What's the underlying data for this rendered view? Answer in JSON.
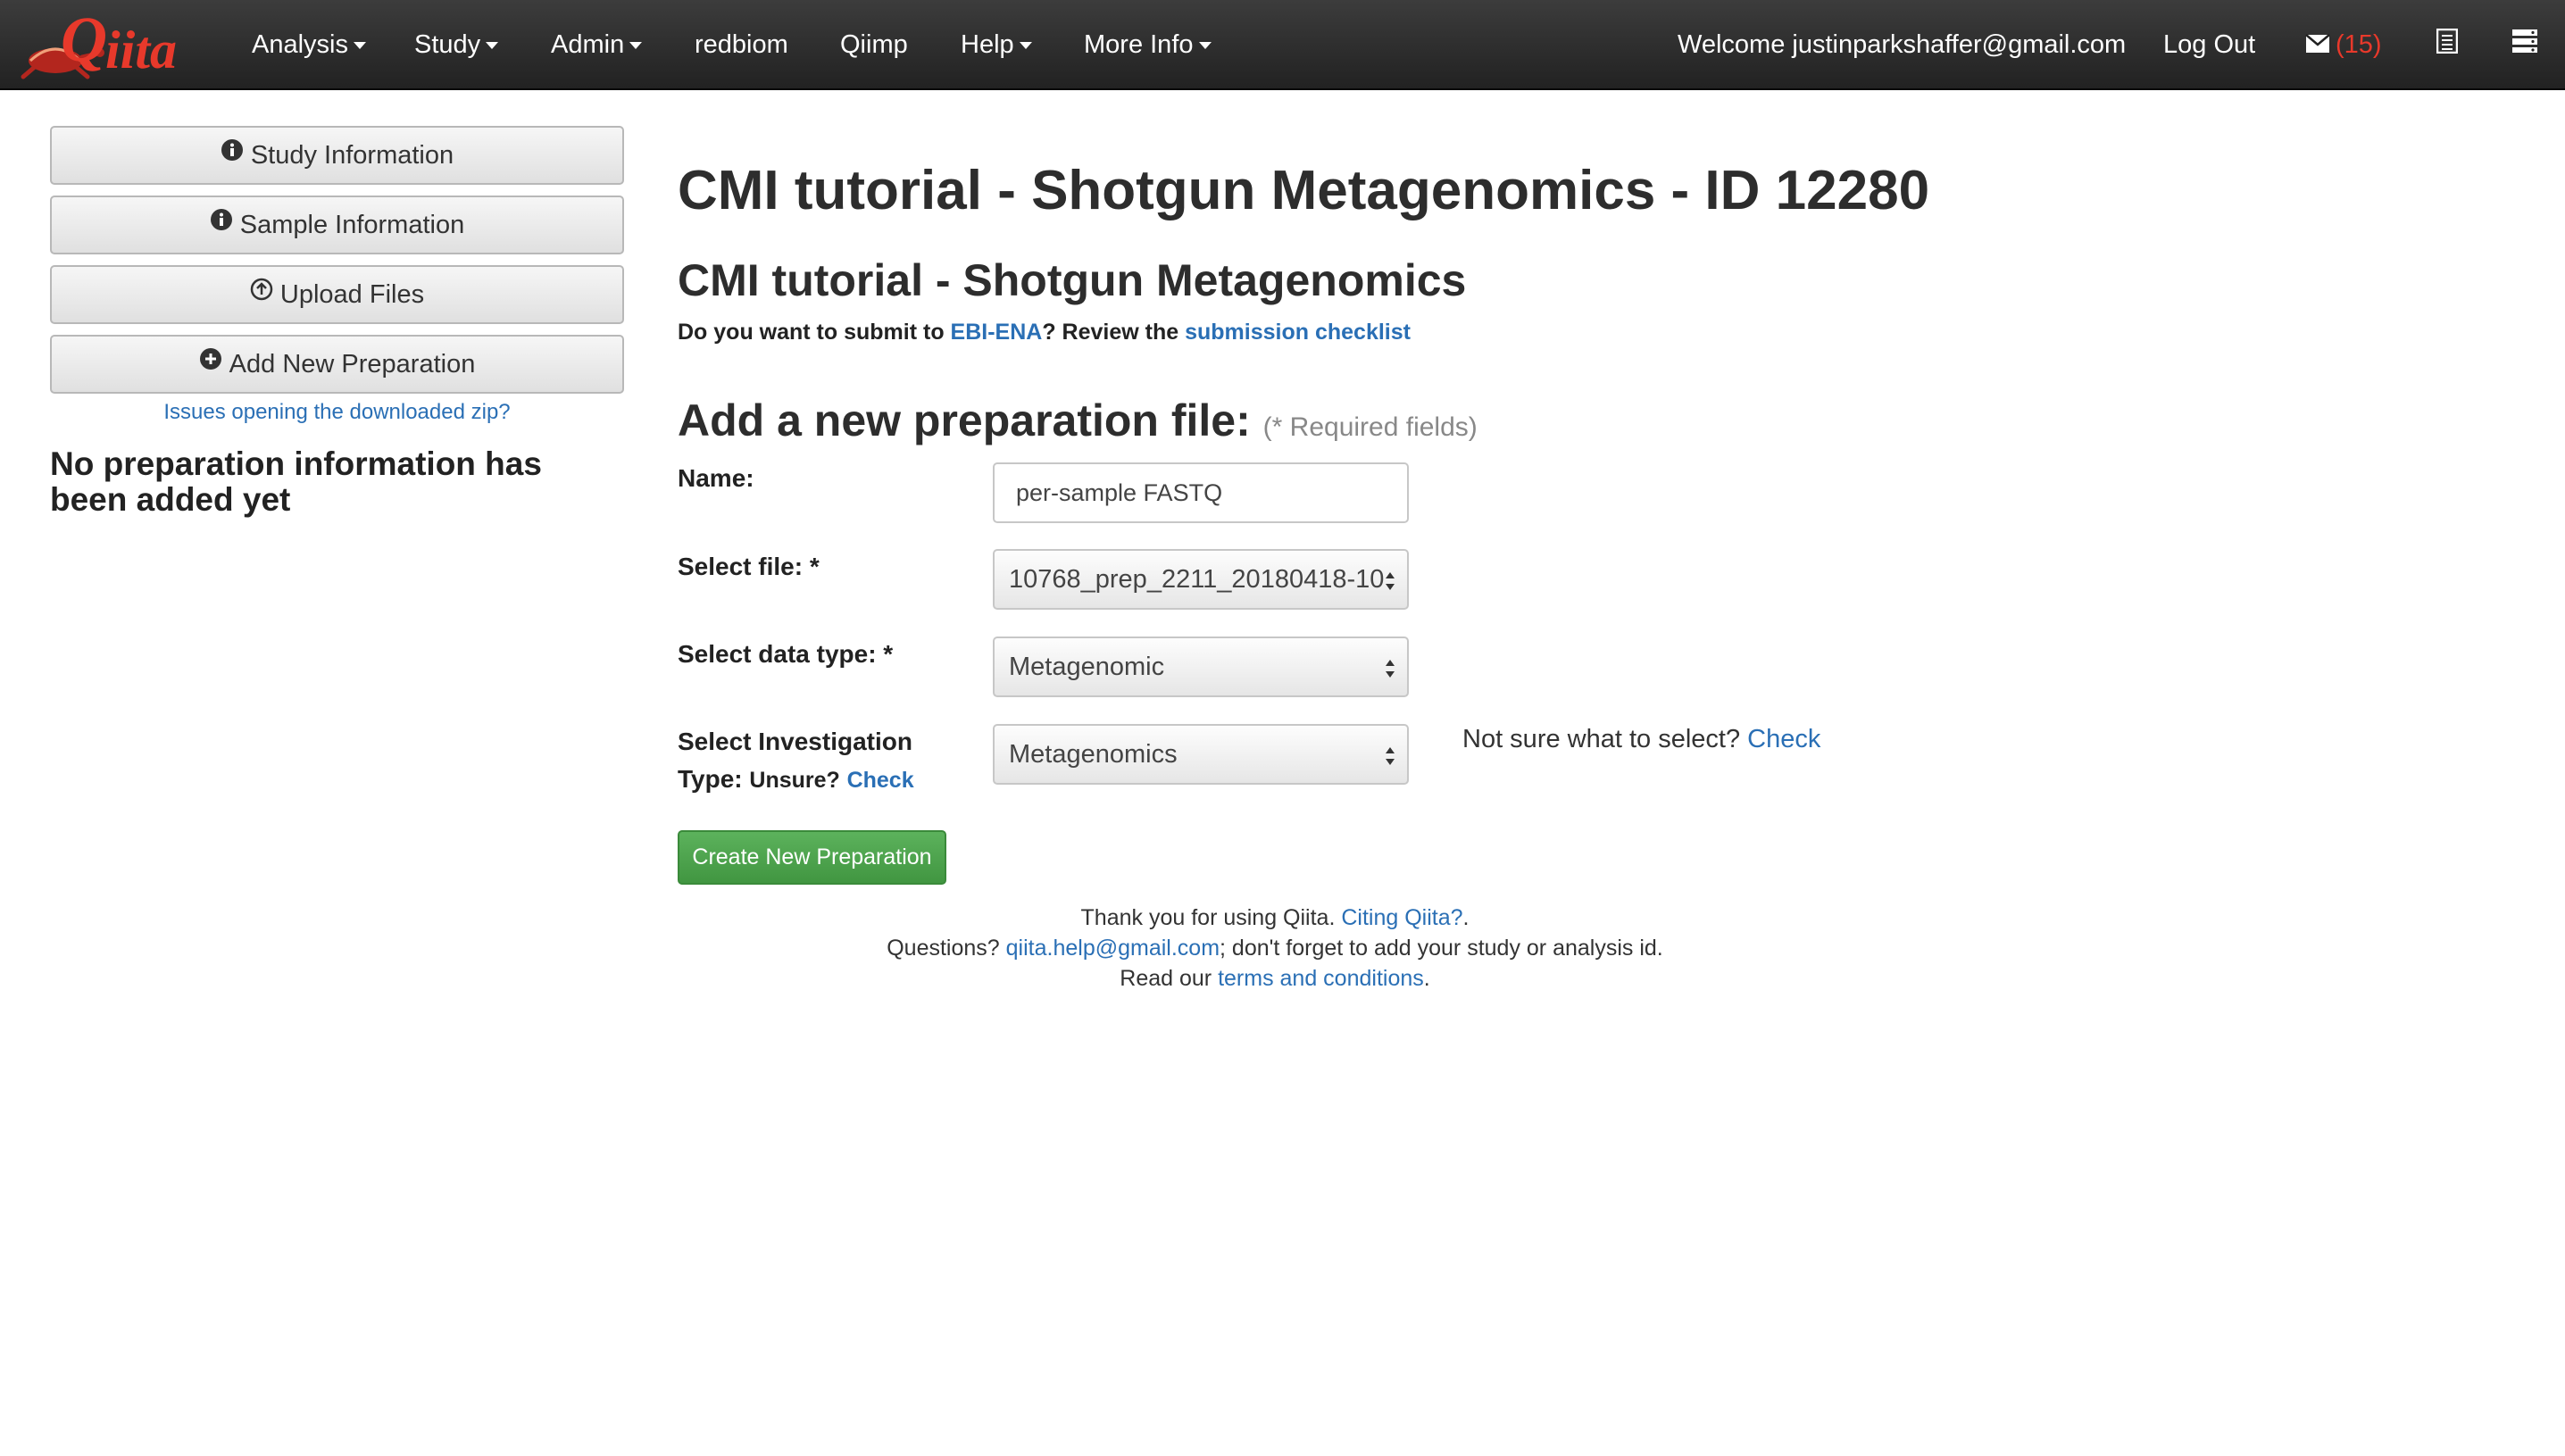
{
  "navbar": {
    "brand": "Qiita",
    "items": [
      {
        "label": "Analysis",
        "dropdown": true
      },
      {
        "label": "Study",
        "dropdown": true
      },
      {
        "label": "Admin",
        "dropdown": true
      },
      {
        "label": "redbiom",
        "dropdown": false
      },
      {
        "label": "Qiimp",
        "dropdown": false
      },
      {
        "label": "Help",
        "dropdown": true
      },
      {
        "label": "More Info",
        "dropdown": true
      }
    ],
    "welcome": "Welcome justinparkshaffer@gmail.com",
    "logout": "Log Out",
    "message_count": "(15)",
    "icons": [
      "envelope-icon",
      "list-icon",
      "server-icon"
    ]
  },
  "sidebar": {
    "buttons": [
      {
        "label": "Study Information",
        "icon": "info-circle-icon"
      },
      {
        "label": "Sample Information",
        "icon": "info-circle-icon"
      },
      {
        "label": "Upload Files",
        "icon": "upload-circle-icon"
      },
      {
        "label": "Add New Preparation",
        "icon": "plus-circle-icon"
      }
    ],
    "zip_link": "Issues opening the downloaded zip?",
    "no_prep_text": "No preparation information has been added yet"
  },
  "main": {
    "title": "CMI tutorial - Shotgun Metagenomics - ID 12280",
    "subtitle": "CMI tutorial - Shotgun Metagenomics",
    "ebi": {
      "prefix": "Do you want to submit to ",
      "link1": "EBI-ENA",
      "middle": "? Review the ",
      "link2": "submission checklist"
    },
    "form_heading": "Add a new preparation file:",
    "required_note": "(* Required fields)",
    "form": {
      "name_label": "Name:",
      "name_value": "per-sample FASTQ",
      "file_label": "Select file: *",
      "file_value": "10768_prep_2211_20180418-10",
      "data_type_label": "Select data type: *",
      "data_type_value": "Metagenomic",
      "investigation_label_1": "Select Investigation",
      "investigation_label_2": "Type:",
      "unsure": "Unsure?",
      "check": "Check",
      "investigation_value": "Metagenomics",
      "not_sure_text": "Not sure what to select?",
      "not_sure_link": "Check",
      "create_button": "Create New Preparation"
    }
  },
  "footer": {
    "line1_text": "Thank you for using Qiita. ",
    "line1_link": "Citing Qiita?",
    "line1_end": ".",
    "line2_text": "Questions? ",
    "line2_link": "qiita.help@gmail.com",
    "line2_end": "; don't forget to add your study or analysis id.",
    "line3_text": "Read our ",
    "line3_link": "terms and conditions",
    "line3_end": "."
  },
  "colors": {
    "navbar_bg": "#222222",
    "brand_red": "#e8392b",
    "link_blue": "#2a6fb5",
    "create_green": "#4cae4c"
  }
}
